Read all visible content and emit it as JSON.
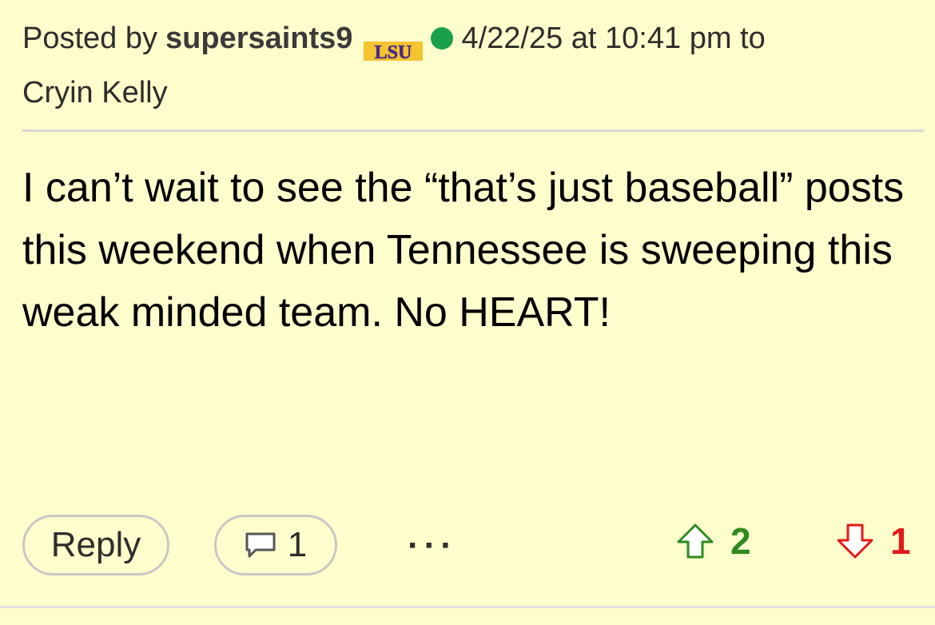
{
  "post": {
    "posted_by_prefix": "Posted by",
    "author": "supersaints9",
    "team_logo_text": "LSU",
    "team_logo_icon": "lsu-logo-icon",
    "online_status_color": "#1aa04a",
    "timestamp": "4/22/25 at 10:41 pm to",
    "reply_to": "Cryin Kelly",
    "body": "I can’t wait to see the “that’s just baseball” posts this weekend when Tennessee is sweeping this weak minded team. No HEART!"
  },
  "footer": {
    "reply_label": "Reply",
    "comment_icon": "comment-bubble-icon",
    "comment_count": "1",
    "more_label": "···",
    "upvote_icon": "arrow-up-icon",
    "upvote_count": "2",
    "upvote_color": "#2e8b1f",
    "downvote_icon": "arrow-down-icon",
    "downvote_count": "1",
    "downvote_color": "#e41a1a"
  },
  "colors": {
    "background": "#fefdcc",
    "lsu_purple": "#4b2a87",
    "lsu_gold": "#f4c430"
  }
}
